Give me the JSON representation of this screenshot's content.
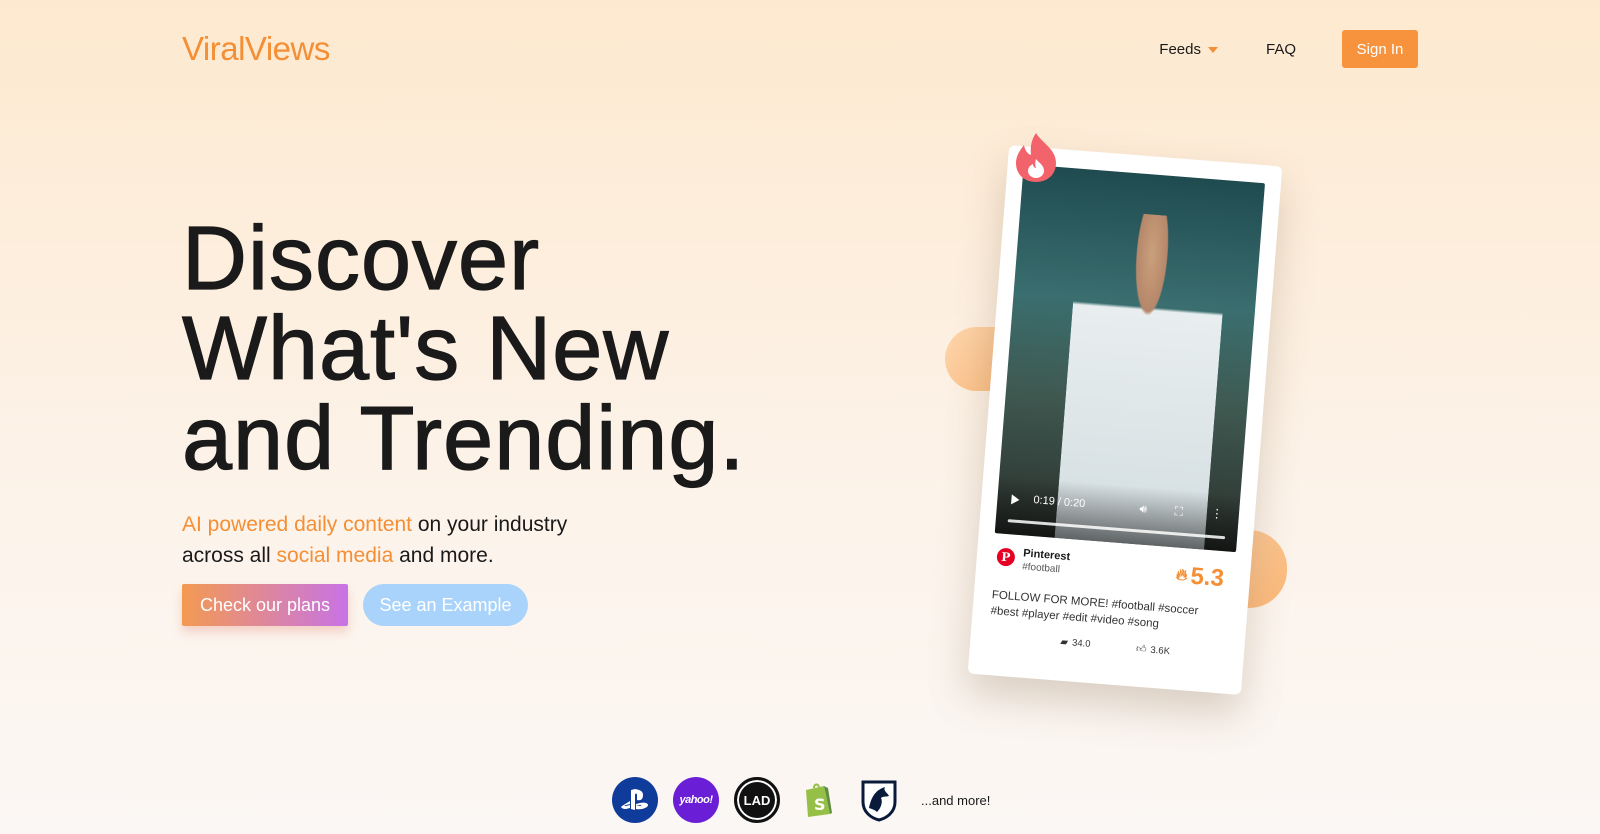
{
  "brand": {
    "name": "ViralViews"
  },
  "nav": {
    "feeds_label": "Feeds",
    "faq_label": "FAQ",
    "signin_label": "Sign In"
  },
  "hero": {
    "headline_lines": [
      "Discover",
      "What's New",
      "and Trending."
    ],
    "sub_part1": "AI powered daily content",
    "sub_part2": " on your industry",
    "sub_part3": "across all ",
    "sub_part4": "social media",
    "sub_part5": " and more.",
    "cta_primary": "Check our plans",
    "cta_secondary": "See an Example"
  },
  "card": {
    "video_time": "0:19 / 0:20",
    "platform": "Pinterest",
    "tag": "#football",
    "score": "5.3",
    "caption": "FOLLOW FOR MORE! #football #soccer #best #player #edit #video #song",
    "comments": "34.0",
    "likes": "3.6K"
  },
  "partners": {
    "logos": [
      "playstation-logo",
      "yahoo-logo",
      "ladbible-logo",
      "shopify-logo",
      "team-liquid-logo"
    ],
    "yahoo_text": "yahoo!",
    "lad_text": "LAD",
    "more_text": "...and more!"
  },
  "colors": {
    "accent": "#f48f35",
    "signin_bg": "#f7933c",
    "example_btn": "#a9d3fb",
    "gradient_start": "#f39a52",
    "gradient_end": "#c873e6"
  }
}
